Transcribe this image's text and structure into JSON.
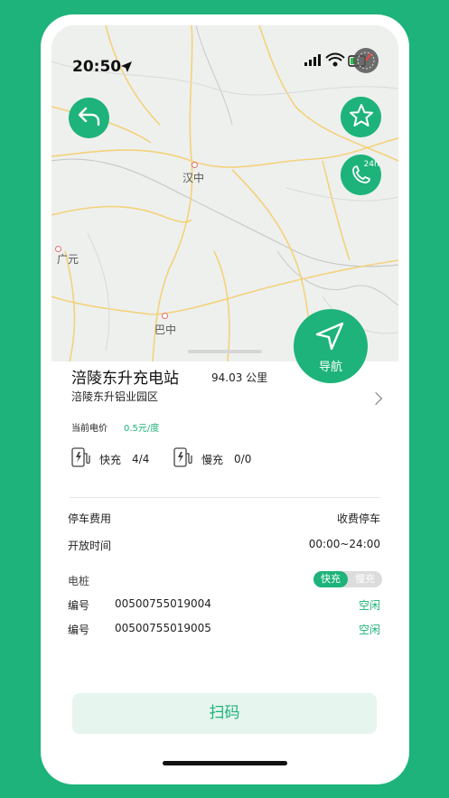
{
  "status_bar": {
    "time": "20:50"
  },
  "map": {
    "labels": {
      "hanzhong": "汉中",
      "guangyuan": "广元",
      "bazhong": "巴中"
    }
  },
  "buttons": {
    "call_badge": "24h",
    "navigate_label": "导航",
    "scan_label": "扫码"
  },
  "station": {
    "name": "涪陵东升充电站",
    "distance": "94.03 公里",
    "address": "涪陵东升铝业园区",
    "price_label": "当前电价",
    "price_value": "0.5元/度"
  },
  "chargers": {
    "fast": {
      "label": "快充",
      "count": "4/4"
    },
    "slow": {
      "label": "慢充",
      "count": "0/0"
    }
  },
  "info": {
    "parking_label": "停车费用",
    "parking_value": "收费停车",
    "hours_label": "开放时间",
    "hours_value": "00:00~24:00"
  },
  "piles": {
    "header": "电桩",
    "toggle": {
      "fast": "快充",
      "slow": "慢充"
    },
    "items": [
      {
        "id_label": "编号",
        "id": "00500755019004",
        "status": "空闲"
      },
      {
        "id_label": "编号",
        "id": "00500755019005",
        "status": "空闲"
      }
    ]
  },
  "colors": {
    "accent": "#1db37a",
    "accent_light": "#e6f5ee",
    "road_yellow": "#f3d27a"
  }
}
